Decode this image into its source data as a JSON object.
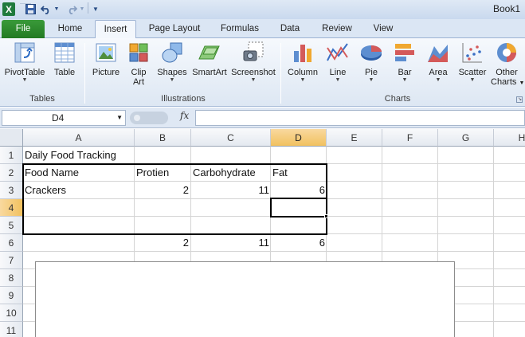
{
  "title_bar": {
    "title": "Book1",
    "app_icon": "excel-icon"
  },
  "tabs": [
    "File",
    "Home",
    "Insert",
    "Page Layout",
    "Formulas",
    "Data",
    "Review",
    "View"
  ],
  "active_tab": "Insert",
  "ribbon": {
    "groups": [
      {
        "label": "Tables",
        "buttons": [
          "PivotTable",
          "Table"
        ]
      },
      {
        "label": "Illustrations",
        "buttons": [
          "Picture",
          "Clip\nArt",
          "Shapes",
          "SmartArt",
          "Screenshot"
        ]
      },
      {
        "label": "Charts",
        "buttons": [
          "Column",
          "Line",
          "Pie",
          "Bar",
          "Area",
          "Scatter",
          "Other\nCharts"
        ]
      }
    ],
    "labels": {
      "pivottable": "PivotTable",
      "table": "Table",
      "picture": "Picture",
      "clipart1": "Clip",
      "clipart2": "Art",
      "shapes": "Shapes",
      "smartart": "SmartArt",
      "screenshot": "Screenshot",
      "column": "Column",
      "line": "Line",
      "pie": "Pie",
      "bar": "Bar",
      "area": "Area",
      "scatter": "Scatter",
      "other1": "Other",
      "other2": "Charts",
      "group_tables": "Tables",
      "group_illustrations": "Illustrations",
      "group_charts": "Charts"
    }
  },
  "formula_bar": {
    "name_box": "D4",
    "fx": "fx",
    "value": ""
  },
  "columns": [
    "A",
    "B",
    "C",
    "D",
    "E",
    "F",
    "G",
    "H"
  ],
  "selected_column": "D",
  "rows": [
    "1",
    "2",
    "3",
    "4",
    "5",
    "6",
    "7",
    "8",
    "9",
    "10",
    "11"
  ],
  "selected_row": "4",
  "cells": {
    "A1": "Daily Food Tracking",
    "A2": "Food Name",
    "B2": "Protien",
    "C2": "Carbohydrate",
    "D2": "Fat",
    "A3": "Crackers",
    "B3": "2",
    "C3": "11",
    "D3": "6",
    "B6": "2",
    "C6": "11",
    "D6": "6"
  },
  "colors": {
    "file_tab": "#2e8b2e",
    "selected_header": "#f5cd7b",
    "grid_line": "#d4d4d4"
  }
}
